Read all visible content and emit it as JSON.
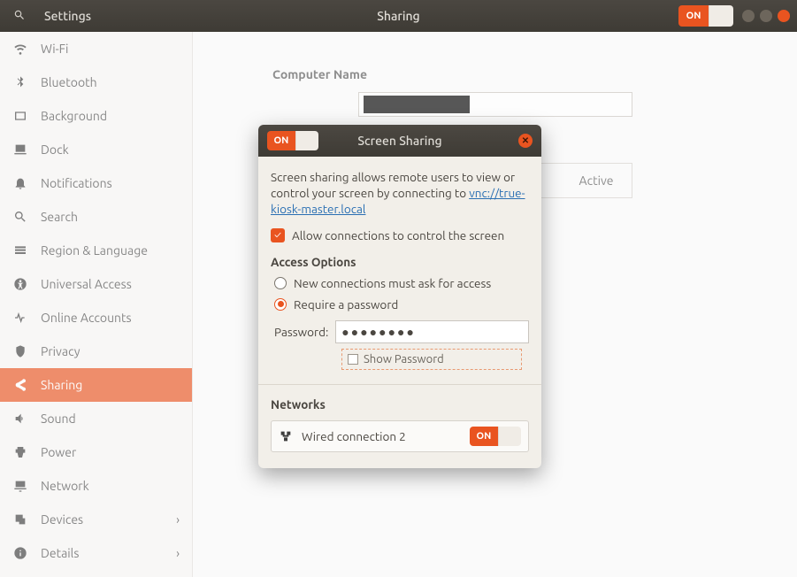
{
  "header": {
    "app_name": "Settings",
    "page_title": "Sharing",
    "toggle_label": "ON"
  },
  "sidebar": {
    "items": [
      {
        "label": "Wi-Fi"
      },
      {
        "label": "Bluetooth"
      },
      {
        "label": "Background"
      },
      {
        "label": "Dock"
      },
      {
        "label": "Notifications"
      },
      {
        "label": "Search"
      },
      {
        "label": "Region & Language"
      },
      {
        "label": "Universal Access"
      },
      {
        "label": "Online Accounts"
      },
      {
        "label": "Privacy"
      },
      {
        "label": "Sharing",
        "active": true
      },
      {
        "label": "Sound"
      },
      {
        "label": "Power"
      },
      {
        "label": "Network"
      },
      {
        "label": "Devices",
        "chevron": true
      },
      {
        "label": "Details",
        "chevron": true
      }
    ]
  },
  "main": {
    "computer_name_label": "Computer Name",
    "screen_sharing_status": "Active"
  },
  "dialog": {
    "toggle_label": "ON",
    "title": "Screen Sharing",
    "desc_prefix": "Screen sharing allows remote users to view or control your screen by connecting to ",
    "vnc_url_text": "vnc://true-kiosk-master.local",
    "allow_control_label": "Allow connections to control the screen",
    "access_options_title": "Access Options",
    "radio_ask_label": "New connections must ask for access",
    "radio_pw_label": "Require a password",
    "password_label": "Password:",
    "password_mask": "●●●●●●●●",
    "show_password_label": "Show Password",
    "networks_title": "Networks",
    "network_name": "Wired connection 2",
    "network_toggle_label": "ON"
  }
}
